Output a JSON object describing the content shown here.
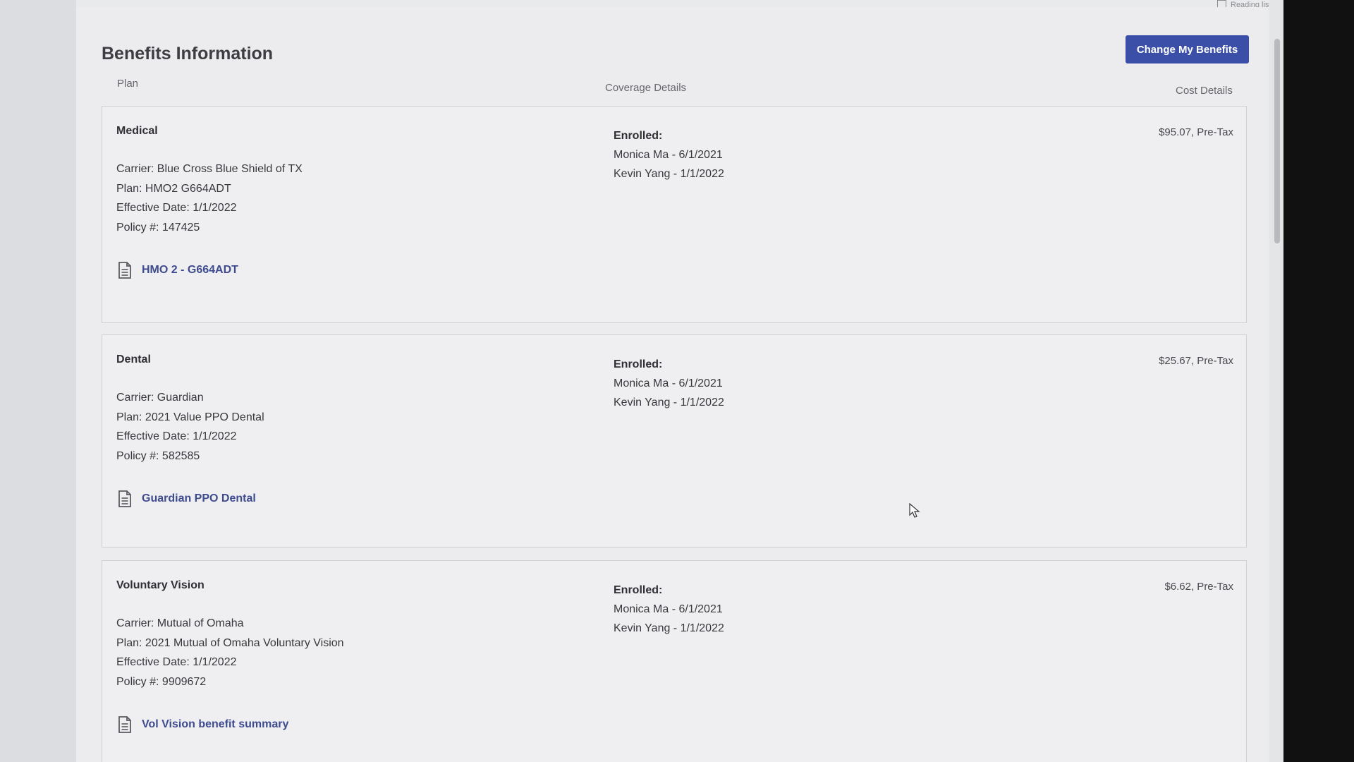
{
  "browser": {
    "reading_list_label": "Reading list"
  },
  "header": {
    "title": "Benefits Information",
    "change_button_label": "Change My Benefits"
  },
  "columns": {
    "plan": "Plan",
    "coverage": "Coverage Details",
    "cost": "Cost Details"
  },
  "plans": [
    {
      "title": "Medical",
      "carrier": "Carrier: Blue Cross Blue Shield of TX",
      "plan": "Plan: HMO2 G664ADT",
      "effective": "Effective Date: 1/1/2022",
      "policy": "Policy #: 147425",
      "doc_link": "HMO 2 - G664ADT",
      "enrolled_label": "Enrolled:",
      "enrolled": [
        "Monica Ma - 6/1/2021",
        "Kevin Yang - 1/1/2022"
      ],
      "cost": "$95.07, Pre-Tax"
    },
    {
      "title": "Dental",
      "carrier": "Carrier: Guardian",
      "plan": "Plan: 2021 Value PPO Dental",
      "effective": "Effective Date: 1/1/2022",
      "policy": "Policy #: 582585",
      "doc_link": "Guardian PPO Dental",
      "enrolled_label": "Enrolled:",
      "enrolled": [
        "Monica Ma - 6/1/2021",
        "Kevin Yang - 1/1/2022"
      ],
      "cost": "$25.67, Pre-Tax"
    },
    {
      "title": "Voluntary Vision",
      "carrier": "Carrier: Mutual of Omaha",
      "plan": "Plan: 2021 Mutual of Omaha Voluntary Vision",
      "effective": "Effective Date: 1/1/2022",
      "policy": "Policy #: 9909672",
      "doc_link": "Vol Vision benefit summary",
      "enrolled_label": "Enrolled:",
      "enrolled": [
        "Monica Ma - 6/1/2021",
        "Kevin Yang - 1/1/2022"
      ],
      "cost": "$6.62, Pre-Tax"
    }
  ],
  "icons": {
    "document": "document-icon"
  },
  "colors": {
    "accent": "#3c4fa8",
    "link": "#3e4b8f"
  }
}
